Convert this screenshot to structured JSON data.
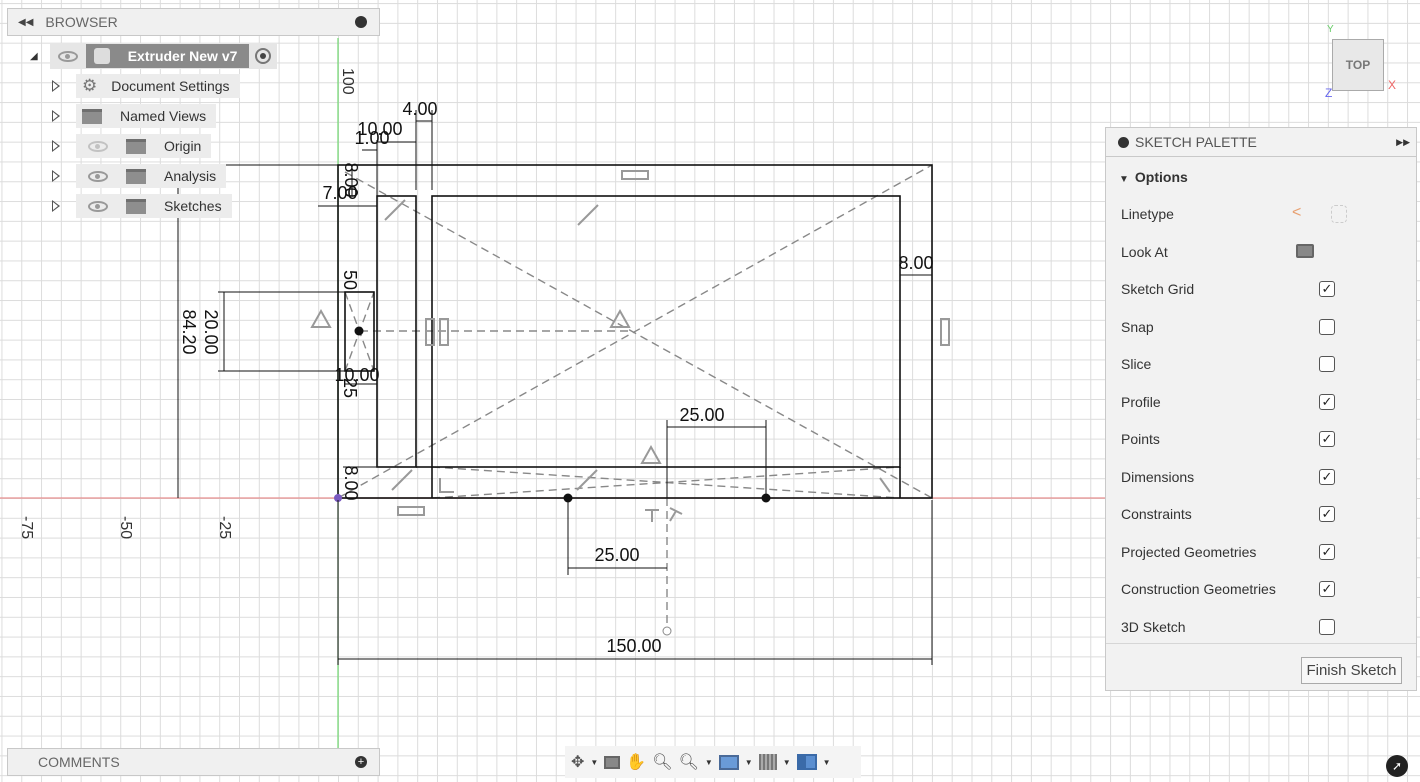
{
  "browser": {
    "title": "BROWSER",
    "root": "Extruder New v7",
    "items": [
      {
        "label": "Document Settings",
        "icon": "gear-icon"
      },
      {
        "label": "Named Views",
        "icon": "folder-icon"
      },
      {
        "label": "Origin",
        "icon": "folder-icon",
        "visibility": "hidden"
      },
      {
        "label": "Analysis",
        "icon": "folder-icon",
        "visibility": "visible"
      },
      {
        "label": "Sketches",
        "icon": "folder-icon",
        "visibility": "visible"
      }
    ]
  },
  "comments": {
    "title": "COMMENTS"
  },
  "viewcube": {
    "face": "TOP",
    "x": "X",
    "y": "Y",
    "z": "Z"
  },
  "axes": {
    "x_labels": [
      "-75",
      "-50",
      "-25"
    ],
    "y_labels": [
      "100"
    ]
  },
  "dimensions": {
    "overall_width": "150.00",
    "overall_height": "84.20",
    "bottom_left": "25.00",
    "top_right": "25.00",
    "right_wall": "8.00",
    "bottom_wall": "8.00",
    "slot_height": "20.00",
    "top_gap": "4.00",
    "top_ten": "10.00",
    "top_one": "1.00",
    "left_seven": "7.00",
    "top_eight": "8.00",
    "small_ten": "10.00",
    "small_fifty": "50",
    "small_25": "25"
  },
  "palette": {
    "title": "SKETCH PALETTE",
    "section": "Options",
    "rows": [
      {
        "label": "Linetype",
        "type": "icons"
      },
      {
        "label": "Look At",
        "type": "icon"
      },
      {
        "label": "Sketch Grid",
        "checked": true
      },
      {
        "label": "Snap",
        "checked": false
      },
      {
        "label": "Slice",
        "checked": false
      },
      {
        "label": "Profile",
        "checked": true
      },
      {
        "label": "Points",
        "checked": true
      },
      {
        "label": "Dimensions",
        "checked": true
      },
      {
        "label": "Constraints",
        "checked": true
      },
      {
        "label": "Projected Geometries",
        "checked": true
      },
      {
        "label": "Construction Geometries",
        "checked": true
      },
      {
        "label": "3D Sketch",
        "checked": false
      }
    ],
    "finish": "Finish Sketch"
  },
  "colors": {
    "x_axis": "#e88a8a",
    "y_axis": "#6cd36c",
    "sketch": "#111111",
    "construction": "#888888"
  }
}
